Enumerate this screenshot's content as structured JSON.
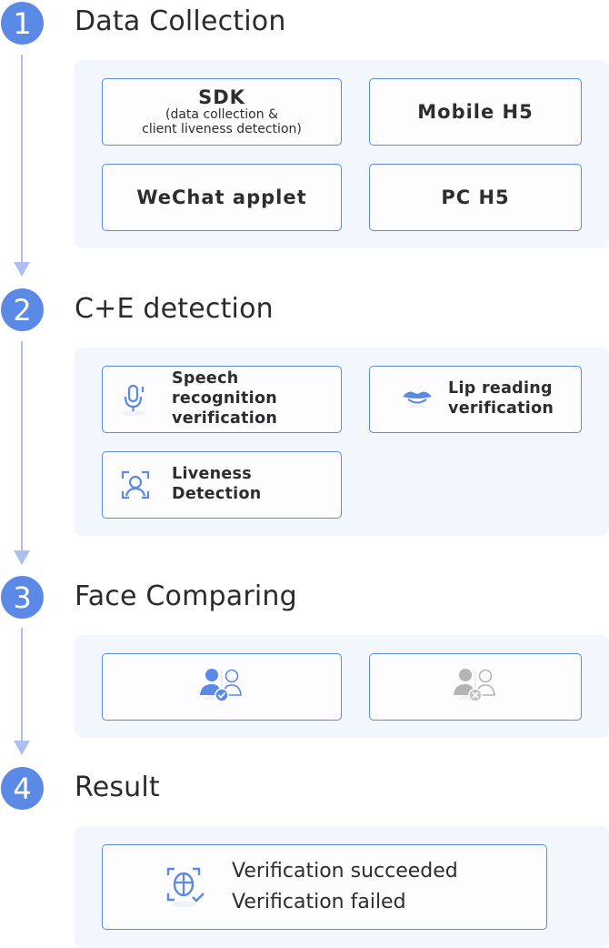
{
  "steps": [
    {
      "number": "1",
      "title": "Data Collection",
      "items": [
        {
          "title": "SDK",
          "subtitle": "(data collection &\nclient liveness detection)",
          "subtitle_line1": "(data collection &",
          "subtitle_line2": "client liveness detection)"
        },
        {
          "title": "Mobile H5"
        },
        {
          "title": "WeChat applet"
        },
        {
          "title": "PC H5"
        }
      ]
    },
    {
      "number": "2",
      "title": "C+E detection",
      "items": [
        {
          "icon": "microphone-icon",
          "line1": "Speech recognition",
          "line2": "verification"
        },
        {
          "icon": "lips-icon",
          "line1": "Lip reading",
          "line2": "verification"
        },
        {
          "icon": "face-scan-icon",
          "line1": "Liveness Detection"
        }
      ]
    },
    {
      "number": "3",
      "title": "Face Comparing",
      "items": [
        {
          "icon": "face-match-success-icon",
          "state": "match"
        },
        {
          "icon": "face-match-fail-icon",
          "state": "mismatch"
        }
      ]
    },
    {
      "number": "4",
      "title": "Result",
      "items": [
        {
          "icon": "face-verify-icon",
          "line1": "Verification succeeded",
          "line2": "Verification failed"
        }
      ]
    }
  ],
  "colors": {
    "accent": "#5b8ae6",
    "connector": "#aebfef",
    "panel_bg": "#f2f6fd",
    "disabled_icon": "#b5b5b5"
  }
}
